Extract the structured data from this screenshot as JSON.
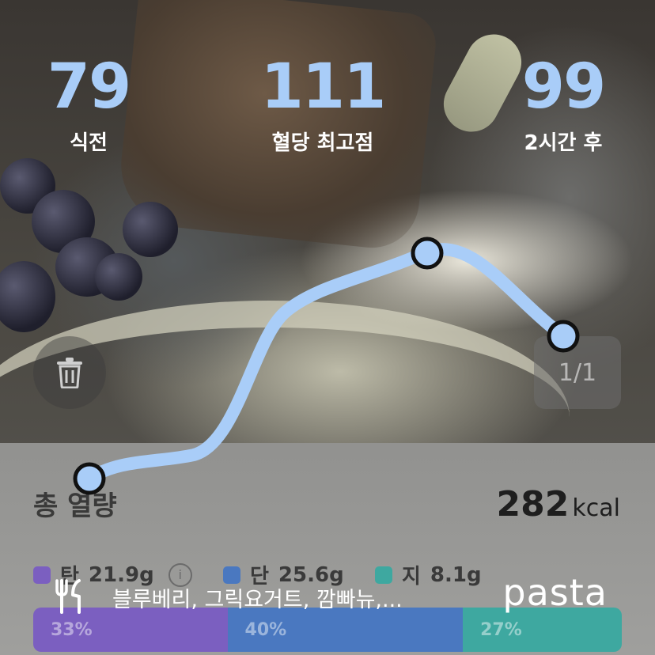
{
  "stats": {
    "before": {
      "value": "79",
      "label": "식전"
    },
    "peak": {
      "value": "111",
      "label": "혈당 최고점"
    },
    "after": {
      "value": "99",
      "label": "2시간 후"
    }
  },
  "pager": {
    "text": "1/1"
  },
  "summary": {
    "total_label": "총 열량",
    "total_value": "282",
    "total_unit": "kcal"
  },
  "macros": [
    {
      "abbr": "탄",
      "value": "21.9g",
      "color": "#7b5fc0",
      "percent": 33,
      "percent_label": "33%"
    },
    {
      "abbr": "단",
      "value": "25.6g",
      "color": "#4a78c0",
      "percent": 40,
      "percent_label": "40%"
    },
    {
      "abbr": "지",
      "value": "8.1g",
      "color": "#3ea8a0",
      "percent": 27,
      "percent_label": "27%"
    }
  ],
  "food": {
    "title": "블루베리, 그릭요거트, 깜빠뉴,..."
  },
  "brand": {
    "name": "pasta"
  },
  "icons": {
    "trash": "trash-icon",
    "fork_knife": "fork-knife-icon",
    "info": "info-icon"
  },
  "colors": {
    "curve": "#a9cdf8",
    "stat_number": "#a9cdf8"
  }
}
